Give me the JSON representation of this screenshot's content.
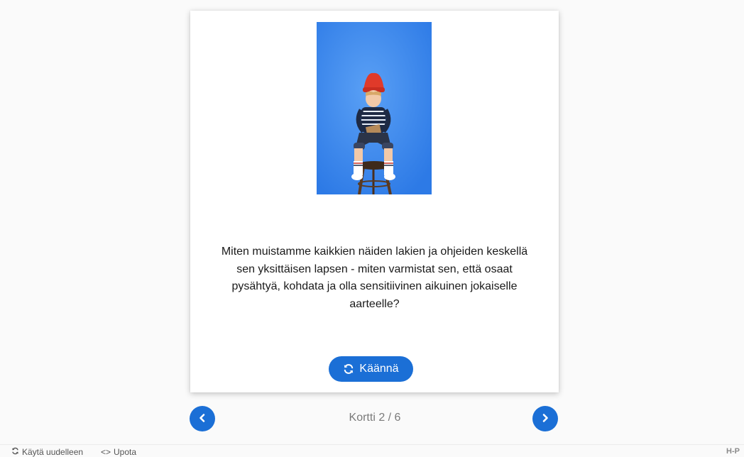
{
  "card": {
    "image_alt": "child-sitting-on-stool-photo",
    "question": "Miten muistamme kaikkien näiden lakien ja ohjeiden keskellä sen yksittäisen lapsen - miten varmistat sen, että osaat pysähtyä, kohdata ja olla sensitiivinen aikuinen jokaiselle aarteelle?",
    "flip_label": "Käännä",
    "flip_icon": "refresh-icon"
  },
  "navigation": {
    "progress": "Kortti 2 / 6",
    "prev_icon": "chevron-left-icon",
    "next_icon": "chevron-right-icon"
  },
  "footer": {
    "reuse_label": "Käytä uudelleen",
    "embed_label": "Upota",
    "embed_icon_text": "<>",
    "logo_text": "H-P"
  },
  "colors": {
    "accent": "#1b6fd6",
    "background": "#fafafa",
    "card": "#ffffff",
    "photo_background": "#3d8cf0"
  }
}
